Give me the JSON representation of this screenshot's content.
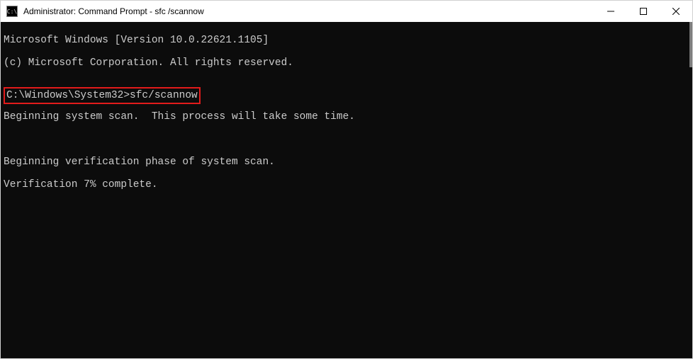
{
  "window": {
    "title": "Administrator: Command Prompt - sfc /scannow",
    "icon_label": "C:\\"
  },
  "terminal": {
    "line1": "Microsoft Windows [Version 10.0.22621.1105]",
    "line2": "(c) Microsoft Corporation. All rights reserved.",
    "prompt_line": "C:\\Windows\\System32>sfc/scannow",
    "line3": "Beginning system scan.  This process will take some time.",
    "line4": "Beginning verification phase of system scan.",
    "line5": "Verification 7% complete."
  },
  "highlight": {
    "color": "#e21b1b"
  }
}
